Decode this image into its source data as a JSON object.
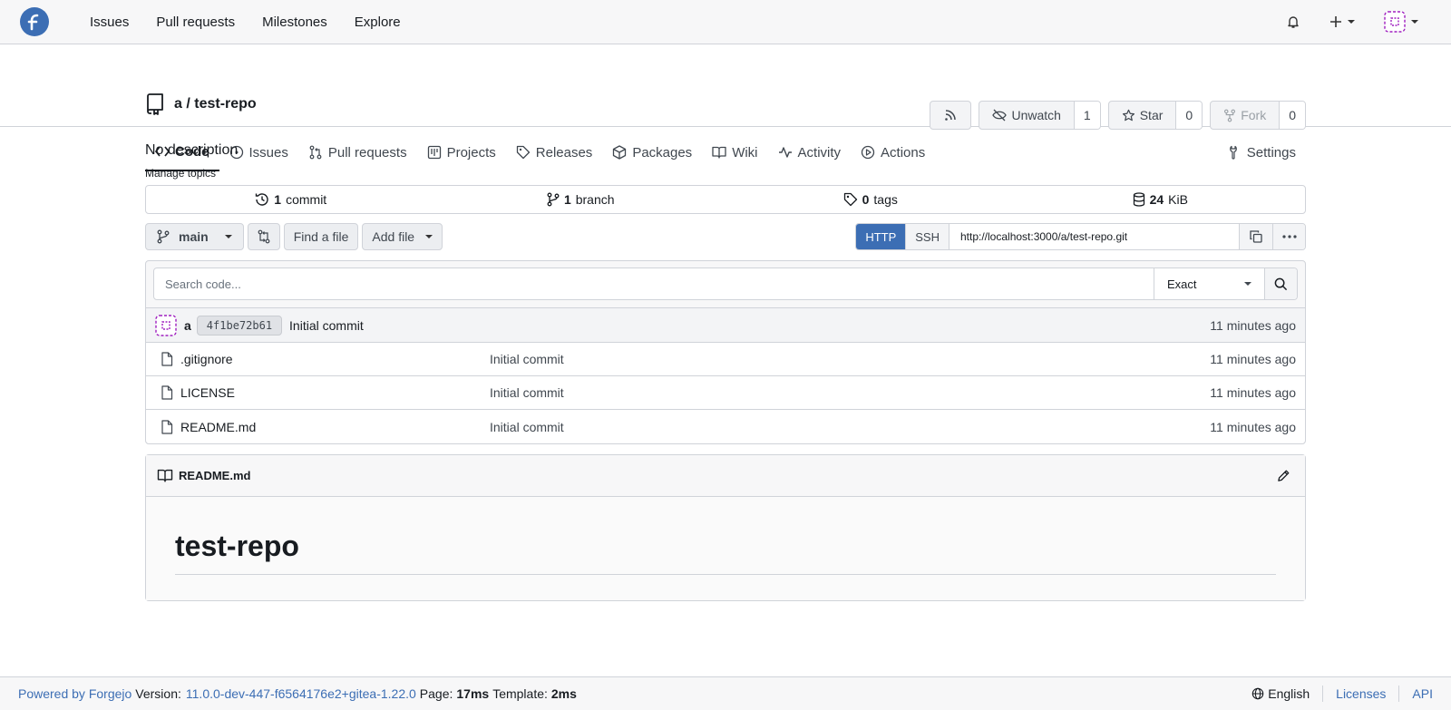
{
  "topnav": {
    "logo": "forgejo-logo-icon",
    "items": [
      {
        "label": "Issues"
      },
      {
        "label": "Pull requests"
      },
      {
        "label": "Milestones"
      },
      {
        "label": "Explore"
      }
    ]
  },
  "repo": {
    "title": "a / test-repo",
    "actions": {
      "watch_label": "Unwatch",
      "watch_count": "1",
      "star_label": "Star",
      "star_count": "0",
      "fork_label": "Fork",
      "fork_count": "0"
    },
    "tabs": [
      {
        "label": "Code",
        "icon": "code-icon"
      },
      {
        "label": "Issues",
        "icon": "issue-icon"
      },
      {
        "label": "Pull requests",
        "icon": "pull-request-icon"
      },
      {
        "label": "Projects",
        "icon": "project-icon"
      },
      {
        "label": "Releases",
        "icon": "tag-icon"
      },
      {
        "label": "Packages",
        "icon": "package-icon"
      },
      {
        "label": "Wiki",
        "icon": "book-icon"
      },
      {
        "label": "Activity",
        "icon": "pulse-icon"
      },
      {
        "label": "Actions",
        "icon": "play-icon"
      },
      {
        "label": "Settings",
        "icon": "tools-icon"
      }
    ],
    "description": "No description",
    "manage_topics": "Manage topics",
    "stats": {
      "commits_num": "1",
      "commits_label": "commit",
      "branches_num": "1",
      "branches_label": "branch",
      "tags_num": "0",
      "tags_label": "tags",
      "size_num": "24",
      "size_unit": "KiB"
    }
  },
  "toolbar": {
    "branch": "main",
    "find_file": "Find a file",
    "add_file": "Add file",
    "clone": {
      "http": "HTTP",
      "ssh": "SSH",
      "url": "http://localhost:3000/a/test-repo.git"
    }
  },
  "search": {
    "placeholder": "Search code...",
    "mode": "Exact"
  },
  "latest_commit": {
    "author": "a",
    "sha": "4f1be72b61",
    "message": "Initial commit",
    "time": "11 minutes ago"
  },
  "files": [
    {
      "name": ".gitignore",
      "message": "Initial commit",
      "time": "11 minutes ago"
    },
    {
      "name": "LICENSE",
      "message": "Initial commit",
      "time": "11 minutes ago"
    },
    {
      "name": "README.md",
      "message": "Initial commit",
      "time": "11 minutes ago"
    }
  ],
  "readme": {
    "filename": "README.md",
    "heading": "test-repo"
  },
  "footer": {
    "powered_by": "Powered by Forgejo",
    "version_label": "Version:",
    "version": "11.0.0-dev-447-f6564176e2+gitea-1.22.0",
    "page_label": "Page:",
    "page_time": "17ms",
    "template_label": "Template:",
    "template_time": "2ms",
    "language": "English",
    "licenses": "Licenses",
    "api": "API"
  }
}
